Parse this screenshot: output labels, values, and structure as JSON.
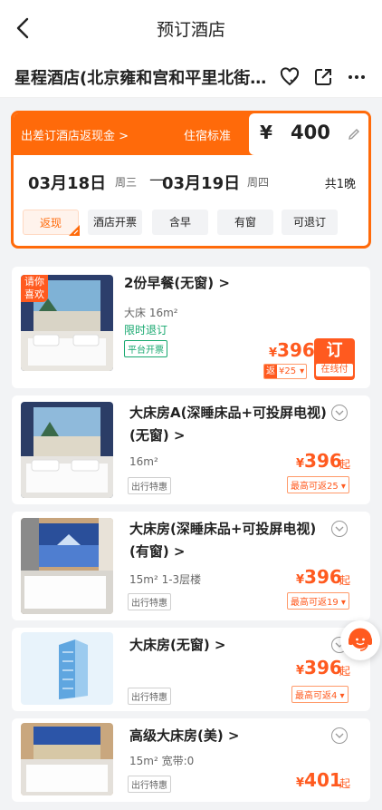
{
  "header": {
    "title": "预订酒店"
  },
  "hotel": {
    "name": "星程酒店(北京雍和宫和平里北街…"
  },
  "booking": {
    "cashback_link": "出差订酒店返现金 >",
    "standard_label": "住宿标准",
    "currency": "¥",
    "price_standard": "400",
    "checkin_date": "03月18日",
    "checkin_weekday": "周三",
    "dash": "—",
    "checkout_date": "03月19日",
    "checkout_weekday": "周四",
    "nights": "共1晚",
    "filters": [
      "返现",
      "酒店开票",
      "含早",
      "有窗",
      "可退订"
    ]
  },
  "rooms": [
    {
      "recommend_tag": "请你喜欢",
      "title": "2份早餐(无窗) >",
      "bed_area": "大床  16m²",
      "refund_note": "限时退订",
      "invoice_badge": "平台开票",
      "price": "396",
      "currency": "¥",
      "book_label": "订",
      "book_sub": "在线付",
      "rebate_icon": "返",
      "rebate_value": "¥25"
    },
    {
      "title_line1": "大床房A(深睡床品+可投屏电视)",
      "title_line2": "(无窗) >",
      "area": "16m²",
      "badge": "出行特惠",
      "price": "396",
      "currency": "¥",
      "suffix": "起",
      "rebate": "最高可返25 ▾"
    },
    {
      "title_line1": "大床房(深睡床品+可投屏电视)",
      "title_line2": "(有窗) >",
      "area": "15m²  1-3层楼",
      "badge": "出行特惠",
      "price": "396",
      "currency": "¥",
      "suffix": "起",
      "rebate": "最高可返19 ▾"
    },
    {
      "title_line1": "大床房(无窗) >",
      "badge": "出行特惠",
      "price": "396",
      "currency": "¥",
      "suffix": "起",
      "rebate": "最高可返4 ▾"
    },
    {
      "title_line1": "高级大床房(美) >",
      "area": "15m²  宽带:0",
      "badge": "出行特惠",
      "price": "401",
      "currency": "¥",
      "suffix": "起"
    }
  ],
  "colors": {
    "accent": "#ff6a0a",
    "price": "#ff5a1f",
    "green": "#17a86f"
  },
  "icons": [
    "back-icon",
    "favorite-heart-icon",
    "share-icon",
    "more-icon",
    "pencil-icon",
    "chevron-down-icon",
    "customer-service-icon"
  ]
}
